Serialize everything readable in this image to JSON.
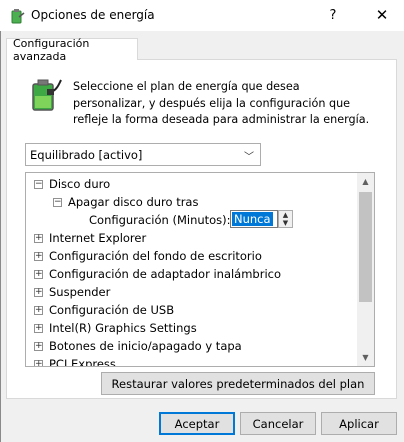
{
  "window": {
    "title": "Opciones de energía",
    "help_glyph": "?",
    "close_glyph": "✕"
  },
  "tab": {
    "label": "Configuración avanzada"
  },
  "description": "Seleccione el plan de energía que desea personalizar, y después elija la configuración que refleje la forma deseada para administrar la energía.",
  "plan_select": {
    "value": "Equilibrado [activo]"
  },
  "tree": {
    "disco_duro": {
      "label": "Disco duro",
      "state": "−"
    },
    "apagar": {
      "label": "Apagar disco duro tras",
      "state": "−"
    },
    "config_minutos": {
      "label": "Configuración (Minutos):",
      "value": "Nunca"
    },
    "items": [
      {
        "label": "Internet Explorer",
        "state": "+"
      },
      {
        "label": "Configuración del fondo de escritorio",
        "state": "+"
      },
      {
        "label": "Configuración de adaptador inalámbrico",
        "state": "+"
      },
      {
        "label": "Suspender",
        "state": "+"
      },
      {
        "label": "Configuración de USB",
        "state": "+"
      },
      {
        "label": "Intel(R) Graphics Settings",
        "state": "+"
      },
      {
        "label": "Botones de inicio/apagado y tapa",
        "state": "+"
      },
      {
        "label": "PCI Express",
        "state": "+"
      }
    ]
  },
  "buttons": {
    "restore": "Restaurar valores predeterminados del plan",
    "accept": "Aceptar",
    "cancel": "Cancelar",
    "apply": "Aplicar"
  },
  "colors": {
    "selection": "#0078d7",
    "panel_bg": "#ffffff",
    "window_bg": "#f0f0f0"
  }
}
